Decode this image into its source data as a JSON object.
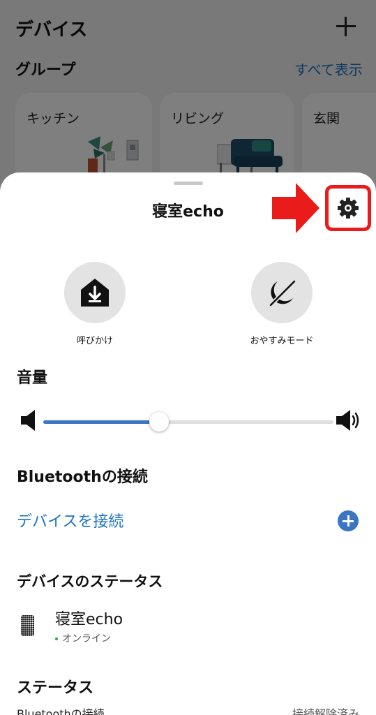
{
  "background": {
    "title": "デバイス",
    "group_label": "グループ",
    "show_all": "すべて表示",
    "groups": [
      {
        "label": "キッチン"
      },
      {
        "label": "リビング"
      },
      {
        "label": "玄関"
      }
    ]
  },
  "sheet": {
    "title": "寝室echo",
    "actions": [
      {
        "label": "呼びかけ",
        "icon": "drop-in-icon"
      },
      {
        "label": "おやすみモード",
        "icon": "do-not-disturb-icon"
      }
    ],
    "volume": {
      "title": "音量",
      "level": 0.4
    },
    "bluetooth": {
      "title": "Bluetoothの接続",
      "connect_label": "デバイスを接続"
    },
    "device_status": {
      "title": "デバイスのステータス",
      "device_name": "寝室echo",
      "status": "オンライン"
    },
    "status": {
      "title": "ステータス",
      "rows": [
        {
          "label": "Bluetoothの接続",
          "value": "接続解除済み"
        }
      ]
    }
  },
  "colors": {
    "accent": "#1a73c7",
    "highlight": "#ea1b1b",
    "online": "#2ea44f"
  }
}
